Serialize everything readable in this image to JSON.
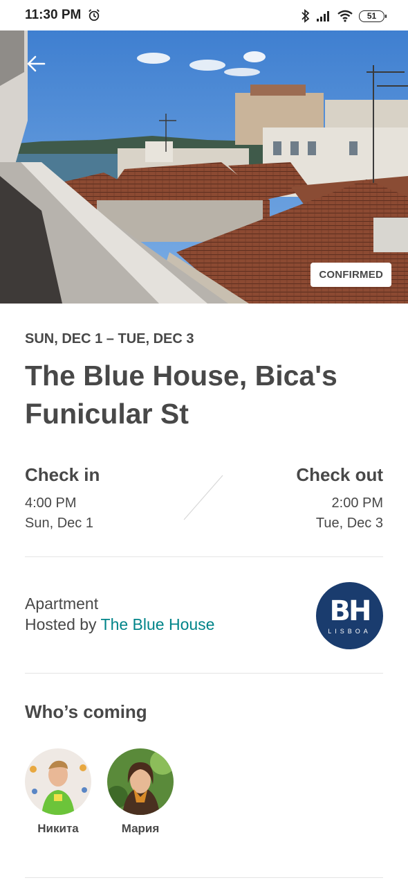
{
  "status_bar": {
    "time": "11:30 PM",
    "battery": "51",
    "icons": [
      "alarm-icon",
      "bluetooth-icon",
      "signal-icon",
      "wifi-icon",
      "battery-icon"
    ]
  },
  "hero": {
    "image": "Rooftop view over Lisbon terracotta roofs toward the river",
    "badge": "CONFIRMED",
    "back_icon": "arrow-left-icon"
  },
  "trip": {
    "dates": "SUN, DEC 1 – TUE, DEC 3",
    "title": "The Blue House, Bica's Funicular St"
  },
  "check_in": {
    "label": "Check in",
    "time": "4:00 PM",
    "date": "Sun, Dec 1"
  },
  "check_out": {
    "label": "Check out",
    "time": "2:00 PM",
    "date": "Tue, Dec 3"
  },
  "host": {
    "type": "Apartment",
    "hosted_by_prefix": "Hosted by ",
    "name": "The Blue House",
    "logo_letters": "BH",
    "logo_sub": "LISBOA"
  },
  "guests": {
    "title": "Who’s coming",
    "people": [
      {
        "name": "Никита"
      },
      {
        "name": "Мария"
      }
    ]
  },
  "colors": {
    "text": "#484848",
    "link": "#008489",
    "logo_bg": "#1a3c6e",
    "divider": "#e4e4e4"
  }
}
